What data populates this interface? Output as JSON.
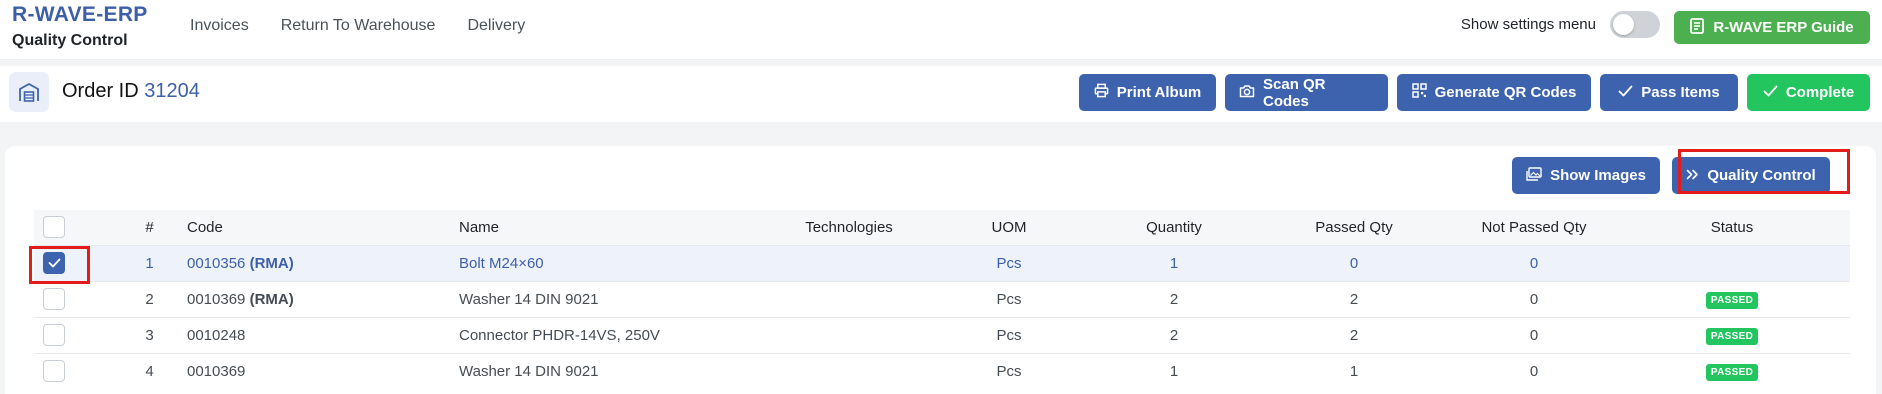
{
  "brand": {
    "title": "R-WAVE-ERP",
    "subtitle": "Quality Control"
  },
  "nav": [
    {
      "label": "Invoices"
    },
    {
      "label": "Return To Warehouse"
    },
    {
      "label": "Delivery"
    }
  ],
  "settings": {
    "label": "Show settings menu",
    "enabled": false
  },
  "guide_button": {
    "label": "R-WAVE ERP Guide",
    "icon": "document-icon"
  },
  "order": {
    "label": "Order ID",
    "id": "31204",
    "icon": "warehouse-icon"
  },
  "actions": {
    "print_album": "Print Album",
    "scan_qr": "Scan QR Codes",
    "generate_qr": "Generate QR Codes",
    "pass_items": "Pass Items",
    "complete": "Complete"
  },
  "card_tools": {
    "show_images": "Show Images",
    "quality_control": "Quality Control"
  },
  "table": {
    "columns": [
      "#",
      "Code",
      "Name",
      "Technologies",
      "UOM",
      "Quantity",
      "Passed Qty",
      "Not Passed Qty",
      "Status"
    ],
    "rows": [
      {
        "num": "1",
        "code": "0010356",
        "tag": "(RMA)",
        "name": "Bolt M24×60",
        "technologies": "",
        "uom": "Pcs",
        "quantity": "1",
        "passed": "0",
        "not_passed": "0",
        "status": "",
        "checked": true
      },
      {
        "num": "2",
        "code": "0010369",
        "tag": "(RMA)",
        "name": "Washer 14 DIN 9021",
        "technologies": "",
        "uom": "Pcs",
        "quantity": "2",
        "passed": "2",
        "not_passed": "0",
        "status": "PASSED",
        "checked": false
      },
      {
        "num": "3",
        "code": "0010248",
        "tag": "",
        "name": "Connector PHDR-14VS, 250V",
        "technologies": "",
        "uom": "Pcs",
        "quantity": "2",
        "passed": "2",
        "not_passed": "0",
        "status": "PASSED",
        "checked": false
      },
      {
        "num": "4",
        "code": "0010369",
        "tag": "",
        "name": "Washer 14 DIN 9021",
        "technologies": "",
        "uom": "Pcs",
        "quantity": "1",
        "passed": "1",
        "not_passed": "0",
        "status": "PASSED",
        "checked": false
      }
    ]
  },
  "colors": {
    "primary": "#3d63ae",
    "success": "#22c55e",
    "guide": "#4caf50",
    "highlight": "#e21b1b"
  }
}
